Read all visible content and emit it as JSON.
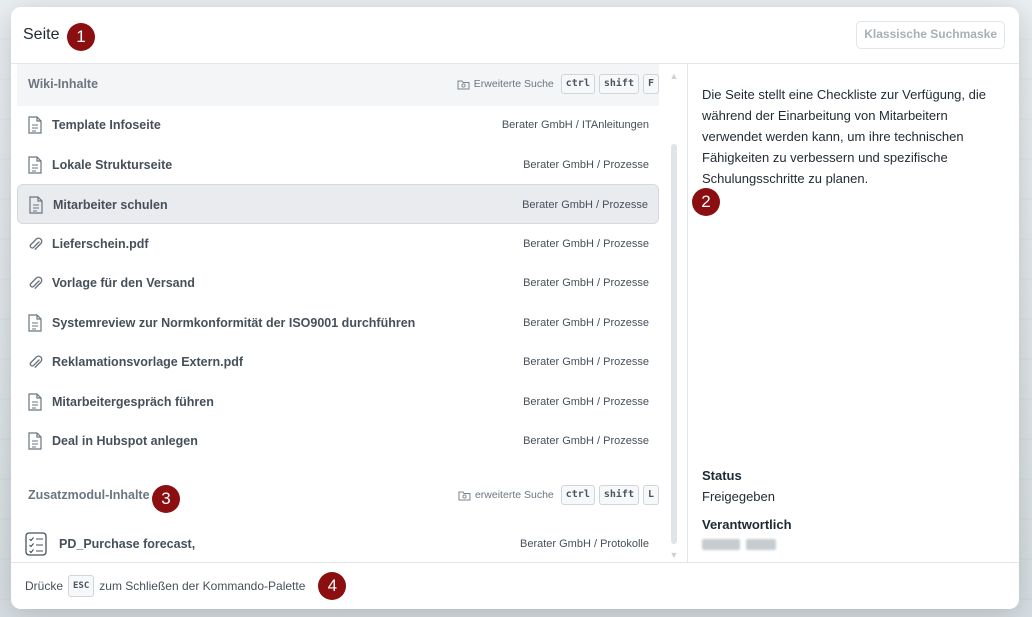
{
  "header": {
    "search_value": "Seite",
    "classic_button": "Klassische Suchmaske"
  },
  "markers": [
    "1",
    "2",
    "3",
    "4"
  ],
  "wiki_section": {
    "title": "Wiki-Inhalte",
    "advanced_search": "Erweiterte Suche",
    "keys": [
      "ctrl",
      "shift",
      "F"
    ],
    "items": [
      {
        "title": "Template Infoseite",
        "path": "Berater GmbH / ITAnleitungen",
        "icon": "document-icon"
      },
      {
        "title": "Lokale Strukturseite",
        "path": "Berater GmbH / Prozesse",
        "icon": "document-icon"
      },
      {
        "title": "Mitarbeiter schulen",
        "path": "Berater GmbH / Prozesse",
        "icon": "document-icon"
      },
      {
        "title": "Lieferschein.pdf",
        "path": "Berater GmbH / Prozesse",
        "icon": "paperclip-icon"
      },
      {
        "title": "Vorlage für den Versand",
        "path": "Berater GmbH / Prozesse",
        "icon": "paperclip-icon"
      },
      {
        "title": "Systemreview zur Normkonformität der ISO9001 durchführen",
        "path": "Berater GmbH / Prozesse",
        "icon": "document-icon"
      },
      {
        "title": "Reklamationsvorlage Extern.pdf",
        "path": "Berater GmbH / Prozesse",
        "icon": "paperclip-icon"
      },
      {
        "title": "Mitarbeitergespräch führen",
        "path": "Berater GmbH / Prozesse",
        "icon": "document-icon"
      },
      {
        "title": "Deal in Hubspot anlegen",
        "path": "Berater GmbH / Prozesse",
        "icon": "document-icon"
      }
    ]
  },
  "addon_section": {
    "title": "Zusatzmodul-Inhalte",
    "advanced_search": "erweiterte Suche",
    "keys": [
      "ctrl",
      "shift",
      "L"
    ],
    "items": [
      {
        "title": "PD_Purchase forecast,",
        "path": "Berater GmbH / Protokolle",
        "icon": "checklist-icon"
      }
    ]
  },
  "preview": {
    "description": "Die Seite stellt eine Checkliste zur Verfügung, die während der Einarbeitung von Mitarbeitern verwendet werden kann, um ihre technischen Fähigkeiten zu verbessern und spezifische Schulungsschritte zu planen.",
    "status_label": "Status",
    "status_value": "Freigegeben",
    "owner_label": "Verantwortlich"
  },
  "footer": {
    "prefix": "Drücke",
    "key": "ESC",
    "suffix": "zum Schließen der Kommando-Palette"
  },
  "colors": {
    "marker": "#8b0e10",
    "selected_row": "#e9ebee"
  }
}
